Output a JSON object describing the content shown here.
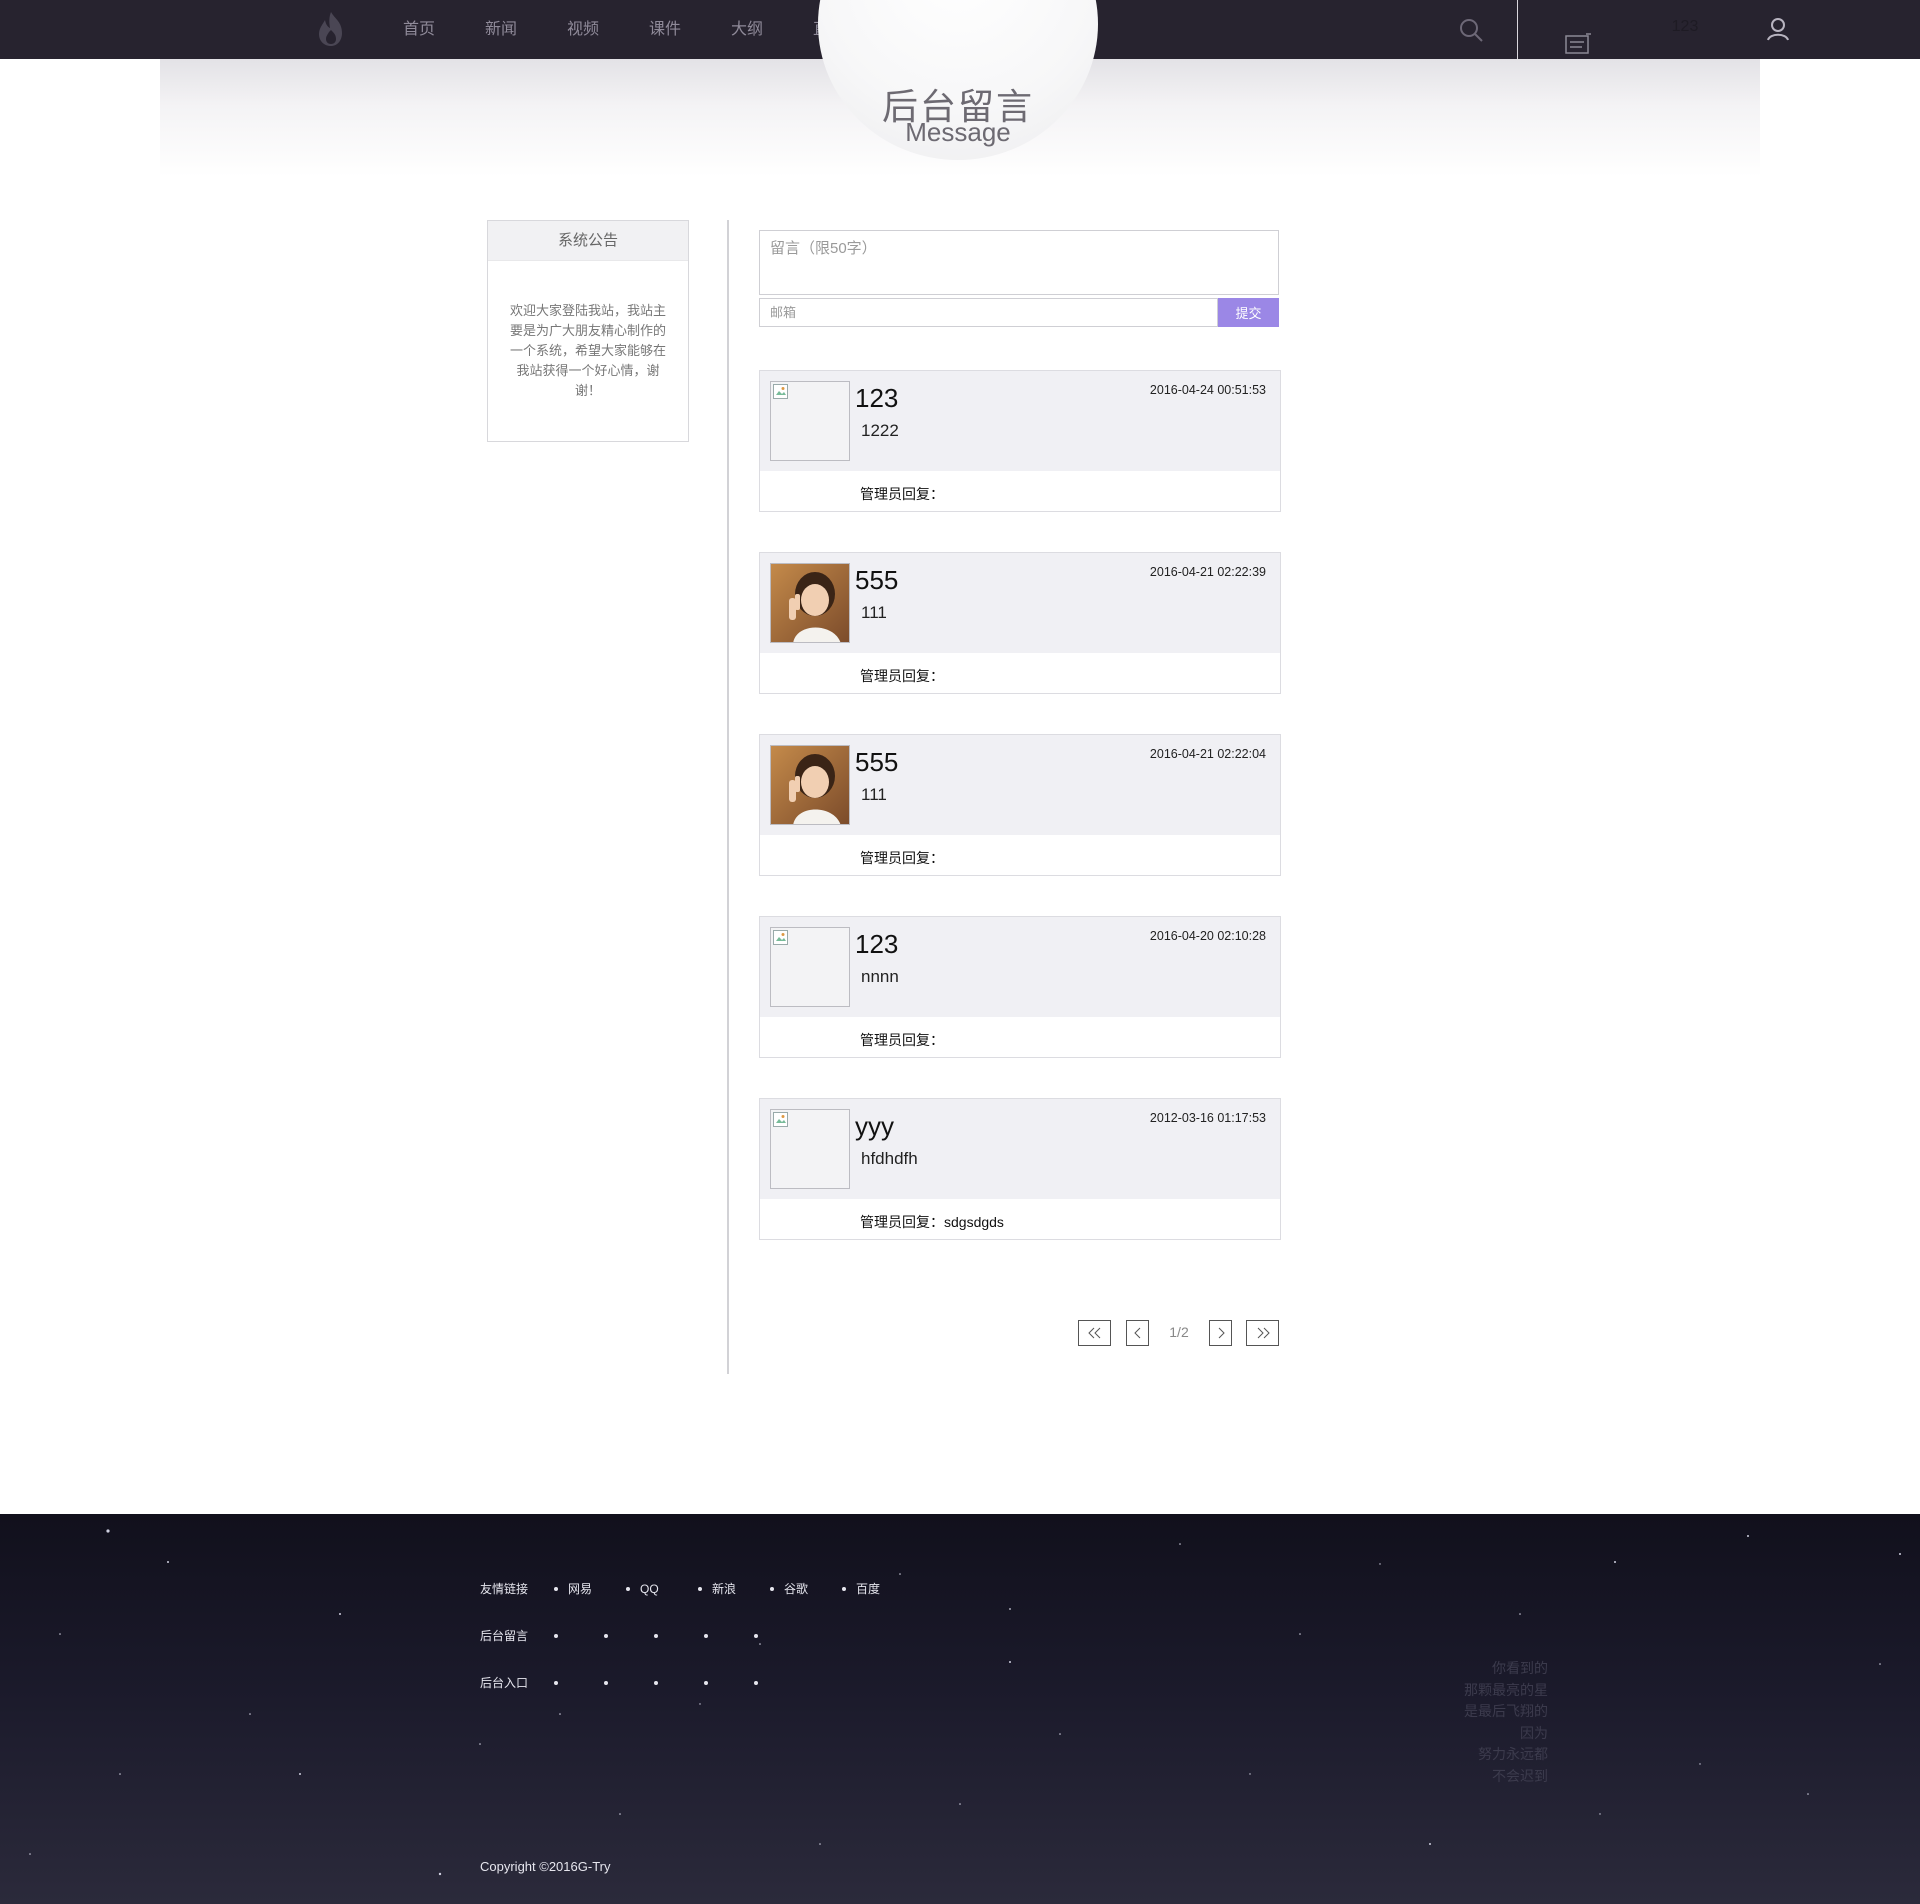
{
  "header": {
    "logo": "flame-logo",
    "nav_items": [
      "首页",
      "新闻",
      "视频",
      "课件",
      "大纲",
      "直播"
    ],
    "username": "123",
    "icons": {
      "search": "search-icon",
      "messages": "message-icon",
      "user": "user-icon"
    }
  },
  "hero": {
    "title": "后台留言",
    "subtitle": "Message"
  },
  "notice": {
    "title": "系统公告",
    "body": "欢迎大家登陆我站，我站主要是为广大朋友精心制作的一个系统，希望大家能够在我站获得一个好心情，谢谢！"
  },
  "form": {
    "message_placeholder": "留言（限50字）",
    "email_placeholder": "邮箱",
    "submit_label": "提交"
  },
  "messages": [
    {
      "name": "123",
      "date": "2016-04-24 00:51:53",
      "content": "1222",
      "reply_label": "管理员回复：",
      "reply": "",
      "avatar": "broken-image"
    },
    {
      "name": "555",
      "date": "2016-04-21 02:22:39",
      "content": "111",
      "reply_label": "管理员回复：",
      "reply": "",
      "avatar": "photo-peace-sign"
    },
    {
      "name": "555",
      "date": "2016-04-21 02:22:04",
      "content": "111",
      "reply_label": "管理员回复：",
      "reply": "",
      "avatar": "photo-peace-sign"
    },
    {
      "name": "123",
      "date": "2016-04-20 02:10:28",
      "content": "nnnn",
      "reply_label": "管理员回复：",
      "reply": "",
      "avatar": "broken-image"
    },
    {
      "name": "yyy",
      "date": "2012-03-16 01:17:53",
      "content": "hfdhdfh",
      "reply_label": "管理员回复：",
      "reply": "sdgsdgds",
      "avatar": "broken-image"
    }
  ],
  "pagination": {
    "first": "«",
    "prev": "‹",
    "next": "›",
    "last": "»",
    "page_text": "1/2",
    "current_page": 1,
    "total_pages": 2
  },
  "footer": {
    "rows": [
      {
        "label": "友情链接",
        "links": [
          "网易",
          "QQ",
          "新浪",
          "谷歌",
          "百度"
        ]
      },
      {
        "label": "后台留言",
        "links": [
          "",
          "",
          "",
          "",
          ""
        ]
      },
      {
        "label": "后台入口",
        "links": [
          "",
          "",
          "",
          "",
          ""
        ]
      }
    ],
    "poem": [
      "你看到的",
      "那颗最亮的星",
      "是最后飞翔的",
      "因为",
      "努力永远都",
      "不会迟到"
    ],
    "copyright": "Copyright ©2016G-Try"
  },
  "colors": {
    "topbar": "#27232f",
    "accent": "#9b87e6",
    "card_bg": "#f0f0f4",
    "footer": "#1b1a2b"
  }
}
